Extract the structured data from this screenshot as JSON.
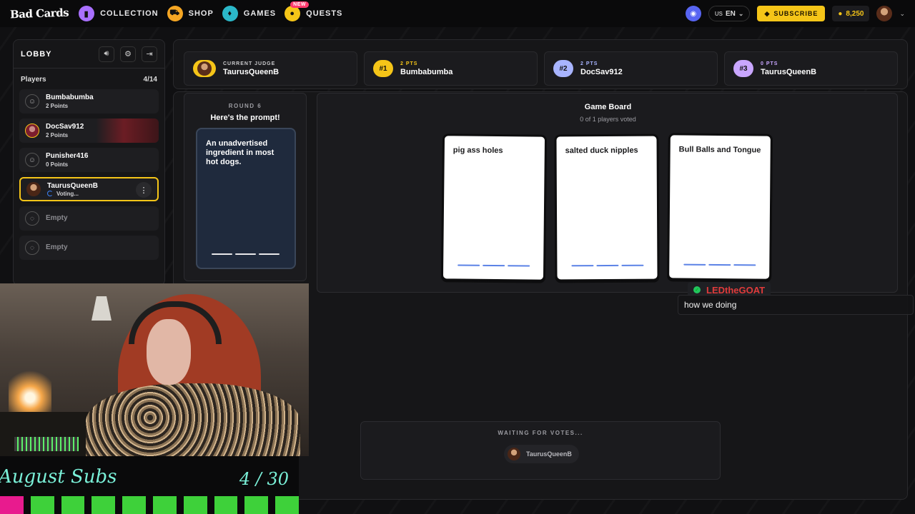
{
  "nav": {
    "logo": "Bad Cards",
    "items": [
      {
        "label": "COLLECTION",
        "color": "#a970ff",
        "icon": "card-icon"
      },
      {
        "label": "SHOP",
        "color": "#f5a623",
        "icon": "cart-icon"
      },
      {
        "label": "GAMES",
        "color": "#2bb8c9",
        "icon": "games-icon"
      },
      {
        "label": "QUESTS",
        "color": "#f5c518",
        "icon": "quests-icon",
        "badge": "NEW"
      }
    ],
    "lang_country": "US",
    "lang": "EN",
    "subscribe_label": "SUBSCRIBE",
    "coins": "8,250"
  },
  "lobby": {
    "title": "LOBBY",
    "players_label": "Players",
    "players_count": "4/14",
    "players": [
      {
        "name": "Bumbabumba",
        "status": "2 Points"
      },
      {
        "name": "DocSav912",
        "status": "2 Points"
      },
      {
        "name": "Punisher416",
        "status": "0 Points"
      },
      {
        "name": "TaurusQueenB",
        "status": "Voting..."
      },
      {
        "name": "Empty"
      },
      {
        "name": "Empty"
      }
    ]
  },
  "scoreboard": {
    "judge_label": "CURRENT JUDGE",
    "judge_name": "TaurusQueenB",
    "ranks": [
      {
        "rank": "#1",
        "pts": "2 PTS",
        "name": "Bumbabumba",
        "color": "#f5c518"
      },
      {
        "rank": "#2",
        "pts": "2 PTS",
        "name": "DocSav912",
        "color": "#a8b4ff"
      },
      {
        "rank": "#3",
        "pts": "0 PTS",
        "name": "TaurusQueenB",
        "color": "#c9a6ff"
      }
    ]
  },
  "round": {
    "label": "ROUND 6",
    "title": "Here's the prompt!",
    "prompt": "An unadvertised ingredient in most hot dogs."
  },
  "board": {
    "title": "Game Board",
    "subtitle": "0 of 1 players voted",
    "cards": [
      "pig ass holes",
      "salted duck nipples",
      "Bull Balls and Tongue"
    ]
  },
  "chat": {
    "username": "LEDtheGOAT",
    "message": "how we doing"
  },
  "waiting": {
    "label": "WAITING FOR VOTES...",
    "player": "TaurusQueenB"
  },
  "subs": {
    "title": "August Subs",
    "count": "4 / 30"
  }
}
